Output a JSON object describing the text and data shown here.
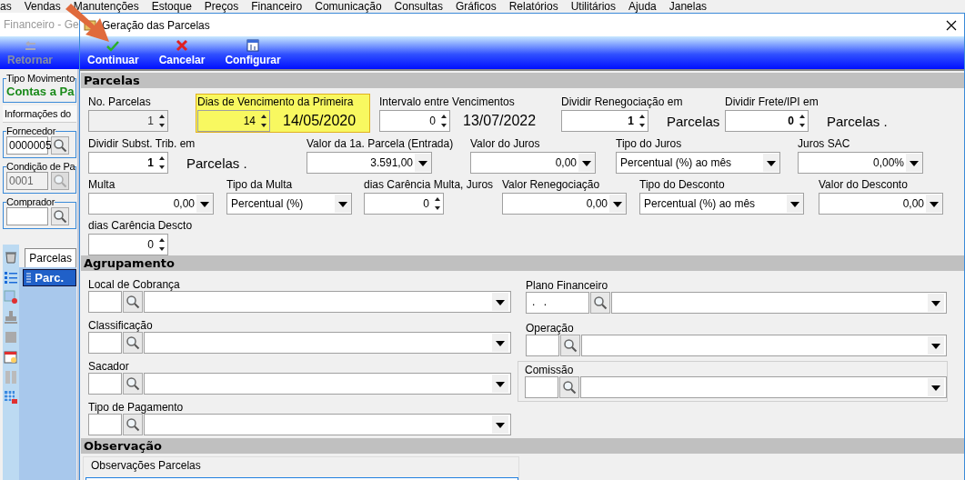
{
  "menu_bar": [
    "as",
    "Vendas",
    "Manutenções",
    "Estoque",
    "Preços",
    "Financeiro",
    "Comunicação",
    "Consultas",
    "Gráficos",
    "Relatórios",
    "Utilitários",
    "Ajuda",
    "Janelas"
  ],
  "background_window": {
    "title": "Financeiro - Ge",
    "toolbar": [
      {
        "label": "Retornar",
        "disabled": true
      }
    ],
    "movement": {
      "label": "Tipo Movimento",
      "value": "Contas a Pa"
    },
    "tab": "Informações do",
    "groups": [
      {
        "label": "Fornecedor",
        "value": "0000005",
        "disabled": false
      },
      {
        "label": "Condição de Pa",
        "value": "0001",
        "disabled": true
      },
      {
        "label": "Comprador",
        "disabled": false
      }
    ],
    "tabs": [
      {
        "label": "Parcelas",
        "selected": true
      }
    ],
    "list": [
      {
        "label": "Parc.",
        "selected": true
      }
    ]
  },
  "dialog": {
    "title": "Geração das Parcelas",
    "toolbar": [
      {
        "kind": "continue",
        "label": "Continuar"
      },
      {
        "kind": "cancel",
        "label": "Cancelar"
      },
      {
        "kind": "configure",
        "label": "Configurar"
      }
    ],
    "parcelas": {
      "title": "Parcelas",
      "rows": [
        [
          {
            "kind": "spinner",
            "label": "No. Parcelas",
            "value": "1",
            "disabled": true,
            "bold": false
          },
          {
            "kind": "spinner",
            "label": "Dias de Vencimento da Primeira",
            "value": "14",
            "highlighted": true,
            "bold": false,
            "date": "14/05/2020"
          },
          {
            "kind": "spinner",
            "label": "Intervalo entre Vencimentos",
            "value": "0",
            "bold": false,
            "date": "13/07/2022"
          },
          {
            "kind": "spinner",
            "label": "Dividir Renegociação em",
            "value": "1",
            "bold": true,
            "suffix": "Parcelas"
          },
          {
            "kind": "spinner",
            "label": "Dividir Frete/IPI em",
            "value": "0",
            "bold": true,
            "suffix": "Parcelas ."
          }
        ],
        [
          {
            "kind": "spinner",
            "label": "Dividir Subst. Trib. em",
            "value": "1",
            "bold": true,
            "suffix": "Parcelas ."
          },
          {
            "kind": "amount",
            "label": "Valor da 1a. Parcela (Entrada)",
            "value": "3.591,00"
          },
          {
            "kind": "amount",
            "label": "Valor do Juros",
            "value": "0,00"
          },
          {
            "kind": "choice",
            "label": "Tipo do Juros",
            "value": "Percentual (%)  ao mês"
          },
          {
            "kind": "amount",
            "label": "Juros SAC",
            "value": "0,00%"
          }
        ],
        [
          {
            "kind": "amount",
            "label": "Multa",
            "value": "0,00"
          },
          {
            "kind": "choice",
            "label": "Tipo da Multa",
            "value": "Percentual (%)"
          },
          {
            "kind": "spinner",
            "label": "dias Carência Multa, Juros",
            "value": "0",
            "bold": false
          },
          {
            "kind": "amount",
            "label": "Valor Renegociação",
            "value": "0,00"
          },
          {
            "kind": "choice",
            "label": "Tipo do Desconto",
            "value": "Percentual (%) ao mês"
          },
          {
            "kind": "amount",
            "label": "Valor do Desconto",
            "value": "0,00"
          }
        ],
        [
          {
            "kind": "spinner",
            "label": "dias Carência Descto",
            "value": "0",
            "bold": false
          }
        ]
      ]
    },
    "agrupamento": {
      "title": "Agrupamento",
      "left": [
        {
          "label": "Local de Cobrança"
        },
        {
          "label": "Classificação"
        },
        {
          "label": "Sacador"
        },
        {
          "label": "Tipo de Pagamento"
        }
      ],
      "right": [
        {
          "label": "Plano Financeiro",
          "code": ". .",
          "framed": false
        },
        {
          "label": "Operação",
          "framed": false
        },
        {
          "label": "Comissão",
          "framed": true
        }
      ]
    },
    "observacao": {
      "title": "Observação",
      "group_label": "Observações Parcelas"
    }
  }
}
